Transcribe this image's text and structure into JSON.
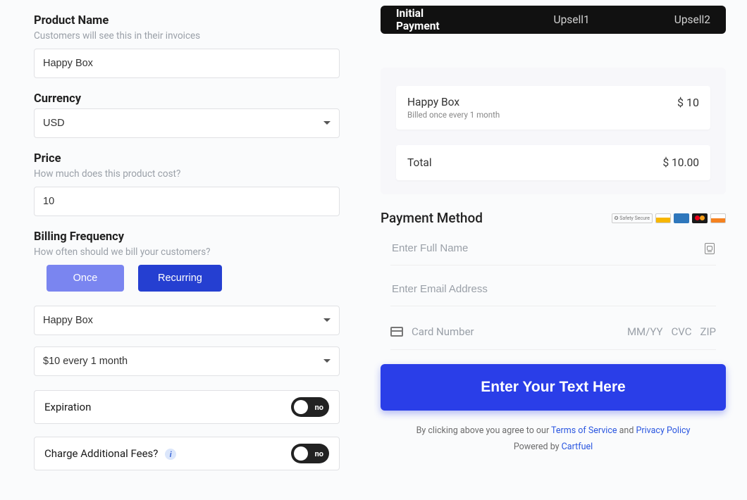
{
  "left": {
    "productName": {
      "label": "Product Name",
      "hint": "Customers will see this in their invoices",
      "value": "Happy Box"
    },
    "currency": {
      "label": "Currency",
      "value": "USD"
    },
    "price": {
      "label": "Price",
      "hint": "How much does this product cost?",
      "value": "10"
    },
    "billing": {
      "label": "Billing Frequency",
      "hint": "How often should we bill your customers?",
      "once": "Once",
      "recurring": "Recurring"
    },
    "planSelect": "Happy Box",
    "intervalSelect": "$10 every 1 month",
    "expiration": {
      "label": "Expiration",
      "toggle": "no"
    },
    "fees": {
      "label": "Charge Additional Fees?",
      "toggle": "no"
    }
  },
  "right": {
    "tabs": {
      "t1": "Initial Payment",
      "t2": "Upsell1",
      "t3": "Upsell2"
    },
    "lineItem": {
      "name": "Happy Box",
      "sub": "Billed once every 1 month",
      "price": "$ 10"
    },
    "total": {
      "label": "Total",
      "value": "$ 10.00"
    },
    "pmTitle": "Payment Method",
    "safety": "✪ Safety Secure",
    "namePh": "Enter Full Name",
    "emailPh": "Enter Email Address",
    "cardPh": "Card Number",
    "mmYY": "MM/YY",
    "cvc": "CVC",
    "zip": "ZIP",
    "cta": "Enter Your Text Here",
    "legal": {
      "pre": "By clicking above you agree to our ",
      "tos": "Terms of Service",
      "and": " and ",
      "pp": "Privacy Policy"
    },
    "powered": {
      "pre": "Powered by ",
      "brand": "Cartfuel"
    }
  }
}
